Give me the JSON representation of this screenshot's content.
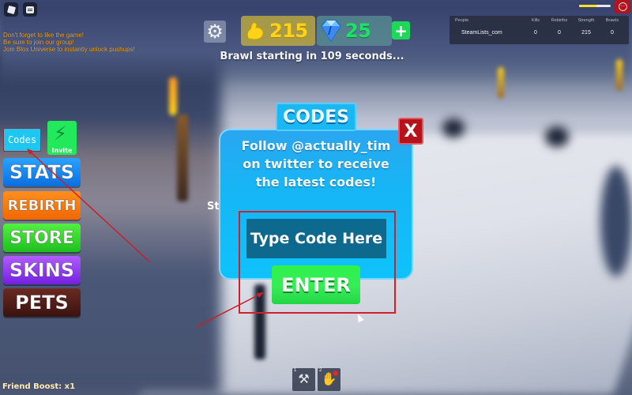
{
  "system": {
    "roblox_menu_icon": "roblox-logo-icon",
    "chat_icon": "chat-icon"
  },
  "notices": [
    "Don't forget to like the game!",
    "Be sure to join our group!",
    "Join Blox Universe to instantly unlock pushups!"
  ],
  "hud": {
    "settings_icon": "gear-icon",
    "strength": {
      "icon": "flexed-bicep-icon",
      "value": "215",
      "color": "#ffd21a"
    },
    "gems": {
      "icon": "diamond-icon",
      "value": "25",
      "color": "#1ee06b"
    },
    "add_label": "+",
    "countdown": "Brawl starting in 109 seconds..."
  },
  "player_status": {
    "health_fraction": 0.55,
    "menu_icon": "more-options-icon"
  },
  "leaderboard": {
    "columns": [
      "People",
      "Kills",
      "Rebirths",
      "Strength",
      "Brawls"
    ],
    "rows": [
      {
        "name": "SteamLists_com",
        "kills": "0",
        "rebirths": "0",
        "strength": "215",
        "brawls": "0"
      }
    ]
  },
  "side_menu": {
    "codes_label": "Codes",
    "invite_label": "Invite",
    "invite_icon": "lightning-bolt-icon",
    "items": [
      {
        "label": "STATS",
        "color": "#1a8af5"
      },
      {
        "label": "REBIRTH",
        "color": "#f87a10"
      },
      {
        "label": "STORE",
        "color": "#38d830"
      },
      {
        "label": "SKINS",
        "color": "#9440f0"
      },
      {
        "label": "PETS",
        "color": "#521e18"
      }
    ]
  },
  "codes_modal": {
    "title": "CODES",
    "close_label": "X",
    "message": "Follow @actually_tim on twitter to receive the latest codes!",
    "input_placeholder": "Type Code Here",
    "input_value": "",
    "enter_label": "ENTER"
  },
  "background_partial_text": "St",
  "friend_boost": "Friend Boost: x1",
  "hotbar": [
    {
      "slot": "1",
      "icon": "dumbbell-icon"
    },
    {
      "slot": "2",
      "icon": "punch-hand-icon"
    }
  ],
  "annotation": {
    "color": "#d0202c"
  }
}
